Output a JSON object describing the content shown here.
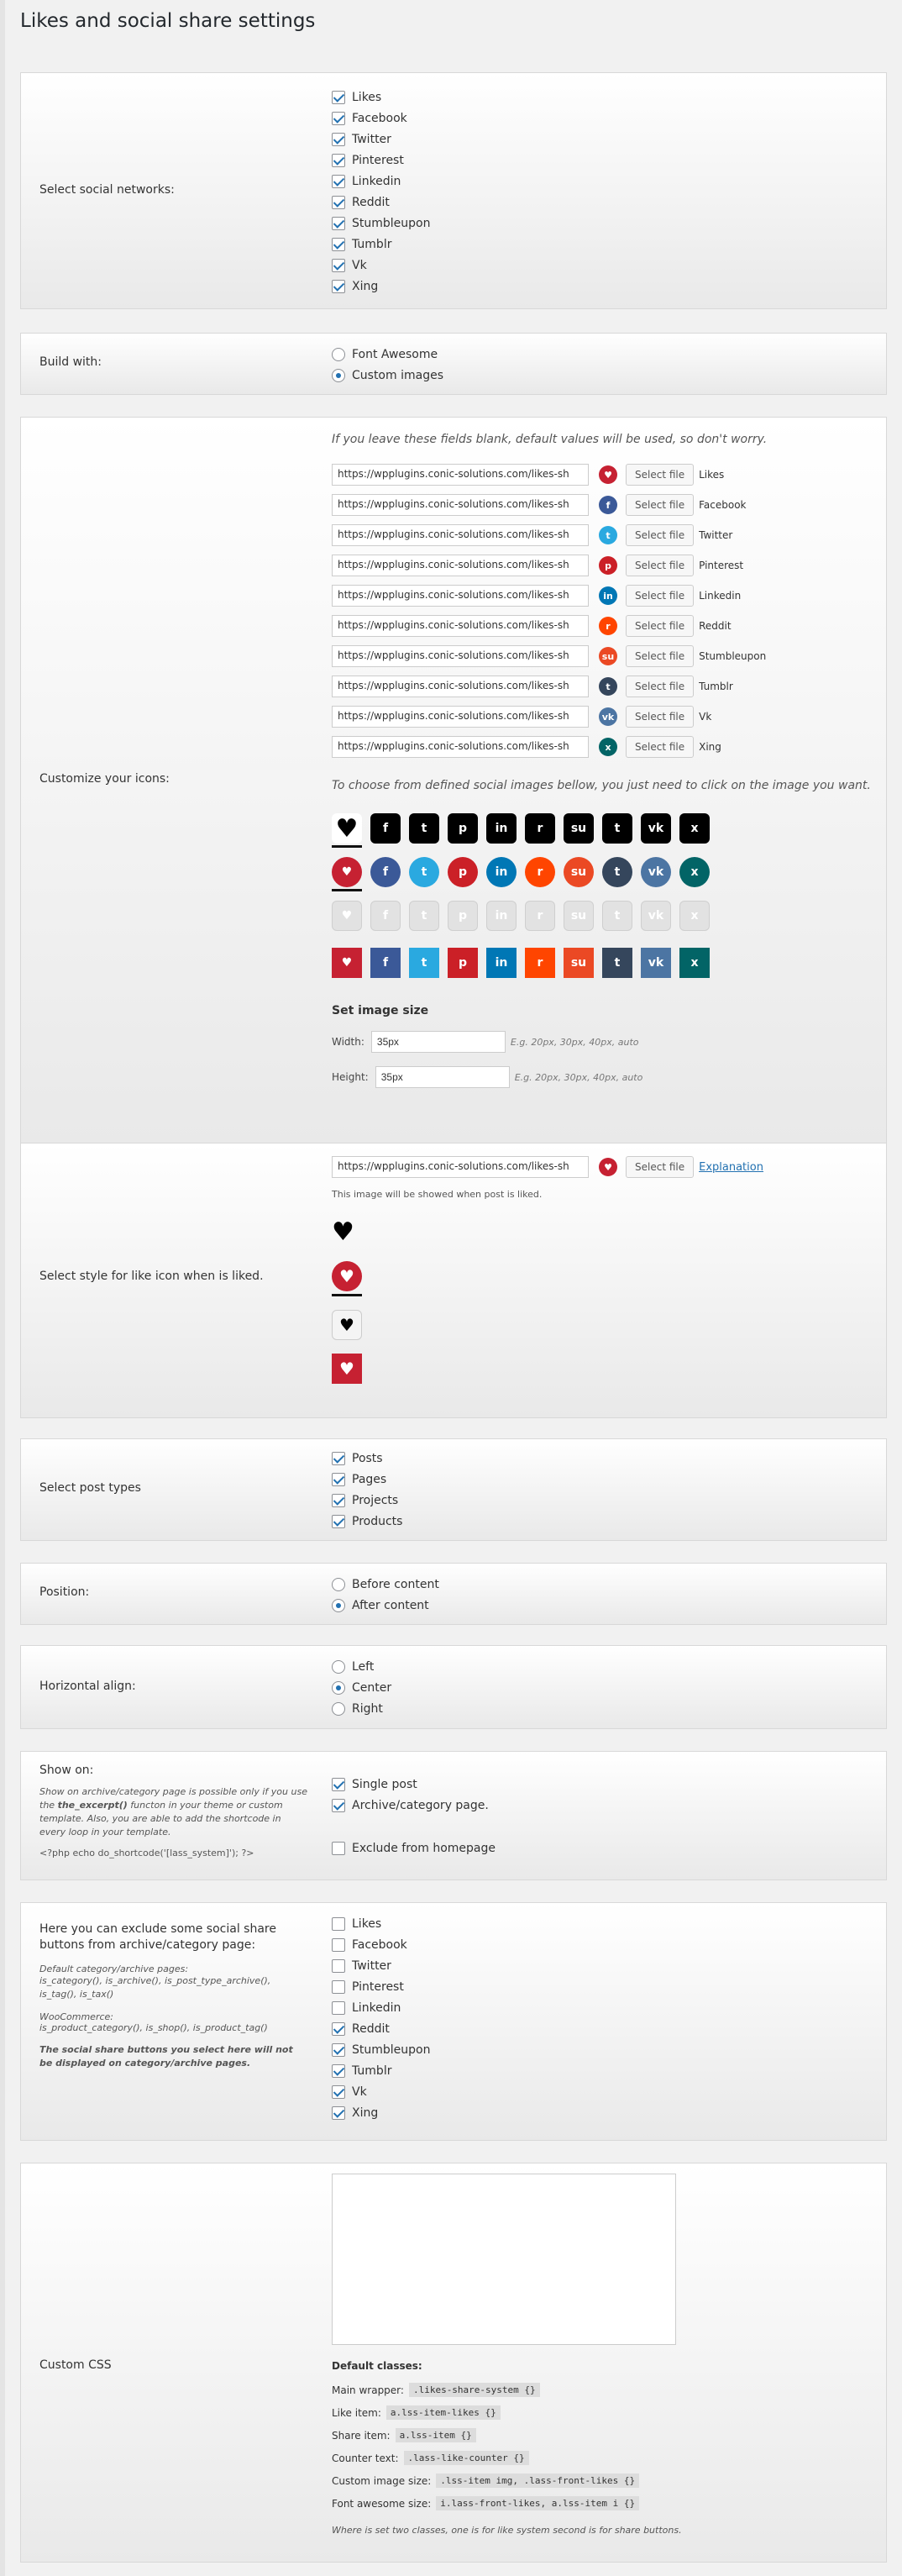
{
  "page_title": "Likes and social share settings",
  "networks": {
    "label": "Select social networks:",
    "items": [
      {
        "name": "Likes",
        "checked": true
      },
      {
        "name": "Facebook",
        "checked": true
      },
      {
        "name": "Twitter",
        "checked": true
      },
      {
        "name": "Pinterest",
        "checked": true
      },
      {
        "name": "Linkedin",
        "checked": true
      },
      {
        "name": "Reddit",
        "checked": true
      },
      {
        "name": "Stumbleupon",
        "checked": true
      },
      {
        "name": "Tumblr",
        "checked": true
      },
      {
        "name": "Vk",
        "checked": true
      },
      {
        "name": "Xing",
        "checked": true
      }
    ]
  },
  "build": {
    "label": "Build with:",
    "options": [
      {
        "name": "Font Awesome",
        "selected": false
      },
      {
        "name": "Custom images",
        "selected": true
      }
    ]
  },
  "icons": {
    "label": "Customize your icons:",
    "note": "If you leave these fields blank, default values will be used, so don't worry.",
    "select_btn": "Select file",
    "url_value": "https://wpplugins.conic-solutions.com/likes-sh",
    "rows": [
      {
        "name": "Likes",
        "color": "#c62132",
        "glyph": "♥"
      },
      {
        "name": "Facebook",
        "color": "#3b5998",
        "glyph": "f"
      },
      {
        "name": "Twitter",
        "color": "#2aa9e0",
        "glyph": "t"
      },
      {
        "name": "Pinterest",
        "color": "#cb2027",
        "glyph": "p"
      },
      {
        "name": "Linkedin",
        "color": "#0077b5",
        "glyph": "in"
      },
      {
        "name": "Reddit",
        "color": "#ff4500",
        "glyph": "r"
      },
      {
        "name": "Stumbleupon",
        "color": "#eb4924",
        "glyph": "su"
      },
      {
        "name": "Tumblr",
        "color": "#35465c",
        "glyph": "t"
      },
      {
        "name": "Vk",
        "color": "#4c75a3",
        "glyph": "vk"
      },
      {
        "name": "Xing",
        "color": "#026466",
        "glyph": "x"
      }
    ],
    "choose_note": "To choose from defined social images bellow, you just need to click on the image you want.",
    "size_title": "Set image size",
    "width_label": "Width:",
    "width_value": "35px",
    "height_label": "Height:",
    "height_value": "35px",
    "size_hint": "E.g. 20px, 30px, 40px, auto"
  },
  "liked": {
    "label": "Select style for like icon when is liked.",
    "url_value": "https://wpplugins.conic-solutions.com/likes-sh",
    "select_btn": "Select file",
    "explanation": "Explanation",
    "note": "This image will be showed when post is liked."
  },
  "post_types": {
    "label": "Select post types",
    "items": [
      {
        "name": "Posts",
        "checked": true
      },
      {
        "name": "Pages",
        "checked": true
      },
      {
        "name": "Projects",
        "checked": true
      },
      {
        "name": "Products",
        "checked": true
      }
    ]
  },
  "position": {
    "label": "Position:",
    "options": [
      {
        "name": "Before content",
        "selected": false
      },
      {
        "name": "After content",
        "selected": true
      }
    ]
  },
  "align": {
    "label": "Horizontal align:",
    "options": [
      {
        "name": "Left",
        "selected": false
      },
      {
        "name": "Center",
        "selected": true
      },
      {
        "name": "Right",
        "selected": false
      }
    ]
  },
  "show_on": {
    "label": "Show on:",
    "desc_1": "Show on archive/category page is possible only if you use the ",
    "desc_bold": "the_excerpt()",
    "desc_2": " functon in your theme or custom template. Also, you are able to add the shortcode in every loop in your template.",
    "shortcode": "<?php echo do_shortcode('[lass_system]'); ?>",
    "items": [
      {
        "name": "Single post",
        "checked": true
      },
      {
        "name": "Archive/category page.",
        "checked": true
      },
      {
        "name": "Exclude from homepage",
        "checked": false
      }
    ]
  },
  "exclude": {
    "label": "Here you can exclude some social share buttons from archive/category page:",
    "default_title": "Default category/archive pages:",
    "default_funcs": "is_category(), is_archive(), is_post_type_archive(), is_tag(), is_tax()",
    "woo_title": "WooCommerce:",
    "woo_funcs": "is_product_category(), is_shop(), is_product_tag()",
    "warning": "The social share buttons you select here will not be displayed on category/archive pages.",
    "items": [
      {
        "name": "Likes",
        "checked": false
      },
      {
        "name": "Facebook",
        "checked": false
      },
      {
        "name": "Twitter",
        "checked": false
      },
      {
        "name": "Pinterest",
        "checked": false
      },
      {
        "name": "Linkedin",
        "checked": false
      },
      {
        "name": "Reddit",
        "checked": true
      },
      {
        "name": "Stumbleupon",
        "checked": true
      },
      {
        "name": "Tumblr",
        "checked": true
      },
      {
        "name": "Vk",
        "checked": true
      },
      {
        "name": "Xing",
        "checked": true
      }
    ]
  },
  "css": {
    "label": "Custom CSS",
    "default_title": "Default classes:",
    "rows": [
      {
        "k": "Main wrapper:",
        "v": ".likes-share-system {}"
      },
      {
        "k": "Like item:",
        "v": "a.lss-item-likes {}"
      },
      {
        "k": "Share item:",
        "v": "a.lss-item {}"
      },
      {
        "k": "Counter text:",
        "v": ".lass-like-counter {}"
      },
      {
        "k": "Custom image size:",
        "v": ".lss-item img, .lass-front-likes {}"
      },
      {
        "k": "Font awesome size:",
        "v": "i.lass-front-likes, a.lss-item i {}"
      }
    ],
    "footnote": "Where is set two classes, one is for like system second is for share buttons."
  }
}
